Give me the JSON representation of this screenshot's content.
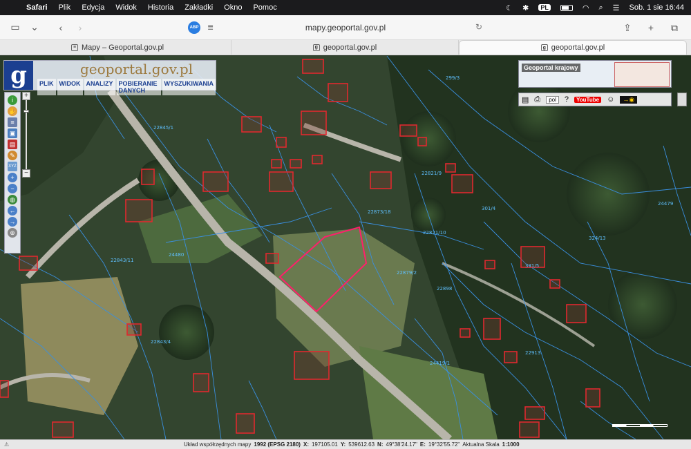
{
  "menubar": {
    "app": "Safari",
    "items": [
      "Plik",
      "Edycja",
      "Widok",
      "Historia",
      "Zakładki",
      "Okno",
      "Pomoc"
    ],
    "lang": "PL",
    "datetime": "Sob. 1 sie  16:44"
  },
  "toolbar": {
    "url": "mapy.geoportal.gov.pl",
    "abp": "ABP"
  },
  "tabs": [
    {
      "label": "Mapy – Geoportal.gov.pl",
      "active": false
    },
    {
      "label": "geoportal.gov.pl",
      "active": false
    },
    {
      "label": "geoportal.gov.pl",
      "active": true
    }
  ],
  "geoportal": {
    "logo_letter": "g",
    "title": "geoportal.gov.pl",
    "menu": [
      "PLIK",
      "WIDOK",
      "ANALIZY",
      "POBIERANIE DANYCH",
      "WYSZUKIWANIA"
    ]
  },
  "overview": {
    "label": "Geoportal krajowy",
    "lang": "pol",
    "youtube": "YouTube"
  },
  "parcels": {
    "labels": [
      {
        "text": "24479"
      },
      {
        "text": "301/4"
      },
      {
        "text": "324/13"
      },
      {
        "text": "331/5"
      },
      {
        "text": "24480"
      },
      {
        "text": "22873/18"
      },
      {
        "text": "22879/2"
      },
      {
        "text": "22898"
      },
      {
        "text": "24419/1"
      },
      {
        "text": "22913"
      },
      {
        "text": "22843/4"
      },
      {
        "text": "22821/10"
      },
      {
        "text": "22821/9"
      },
      {
        "text": "299/3"
      },
      {
        "text": "22843/11"
      },
      {
        "text": "22845/1"
      }
    ]
  },
  "status": {
    "system_label": "Układ współrzędnych mapy",
    "system_value": "1992 (EPSG 2180)",
    "x_label": "X:",
    "x_value": "197105.01",
    "y_label": "Y:",
    "y_value": "539612.63",
    "n_label": "N:",
    "n_value": "49°38'24.17\"",
    "e_label": "E:",
    "e_value": "19°32'55.72\"",
    "scale_label": "Aktualna Skala",
    "scale_value": "1:1000"
  }
}
